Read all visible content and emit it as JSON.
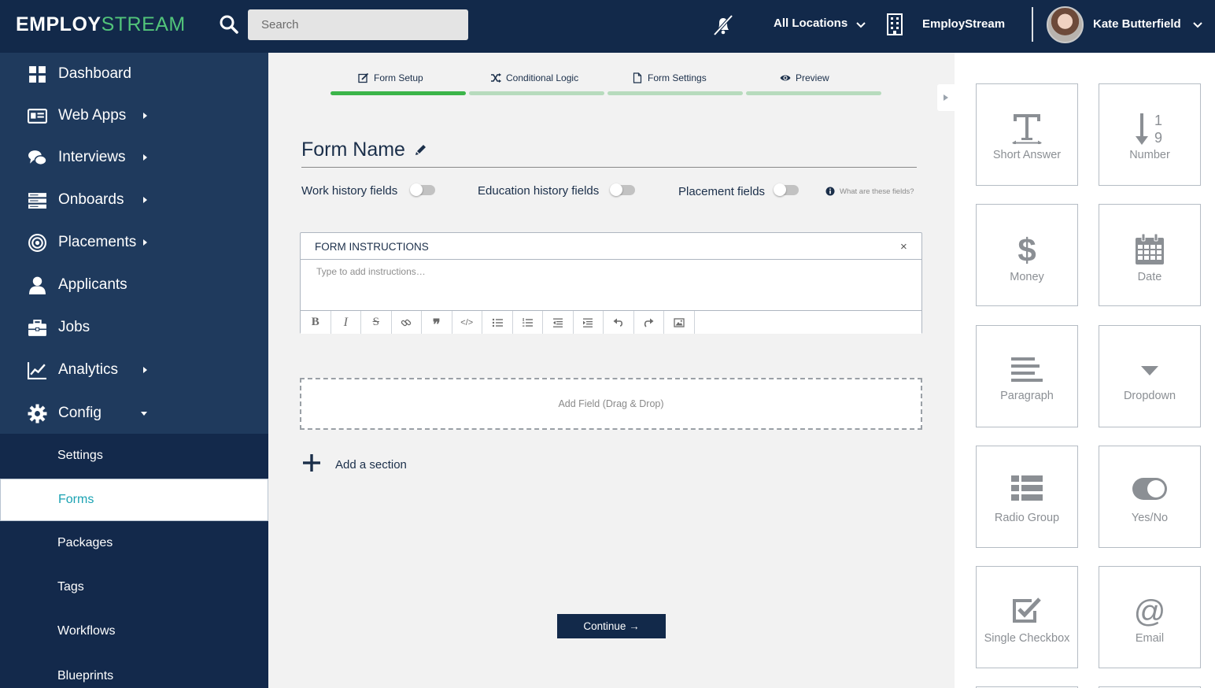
{
  "topbar": {
    "logo_part1": "EMPLOY",
    "logo_part2": "STREAM",
    "search_placeholder": "Search",
    "location": "All Locations",
    "organization": "EmployStream",
    "user_name": "Kate Butterfield",
    "icons": [
      "search-icon",
      "bell-off-icon",
      "chevron-down-icon",
      "building-icon",
      "chevron-down-icon"
    ]
  },
  "sidebar": {
    "items": [
      {
        "label": "Dashboard",
        "icon": "grid-icon",
        "has_submenu": false
      },
      {
        "label": "Web Apps",
        "icon": "id-card-icon",
        "has_submenu": true
      },
      {
        "label": "Interviews",
        "icon": "chat-icon",
        "has_submenu": true
      },
      {
        "label": "Onboards",
        "icon": "server-icon",
        "has_submenu": true
      },
      {
        "label": "Placements",
        "icon": "target-icon",
        "has_submenu": true
      },
      {
        "label": "Applicants",
        "icon": "user-icon",
        "has_submenu": false
      },
      {
        "label": "Jobs",
        "icon": "briefcase-icon",
        "has_submenu": false
      },
      {
        "label": "Analytics",
        "icon": "line-chart-icon",
        "has_submenu": true
      },
      {
        "label": "Config",
        "icon": "gear-icon",
        "has_submenu": true,
        "expanded": true
      }
    ],
    "config_subitems": [
      {
        "label": "Settings",
        "active": false
      },
      {
        "label": "Forms",
        "active": true
      },
      {
        "label": "Packages",
        "active": false
      },
      {
        "label": "Tags",
        "active": false
      },
      {
        "label": "Workflows",
        "active": false
      },
      {
        "label": "Blueprints",
        "active": false
      }
    ]
  },
  "steps": [
    {
      "label": "Form Setup",
      "icon": "edit-icon",
      "active": true
    },
    {
      "label": "Conditional Logic",
      "icon": "shuffle-icon",
      "active": false
    },
    {
      "label": "Form Settings",
      "icon": "file-icon",
      "active": false
    },
    {
      "label": "Preview",
      "icon": "eye-icon",
      "active": false
    }
  ],
  "form": {
    "title": "Form Name",
    "toggles": [
      {
        "label": "Work history fields",
        "on": false
      },
      {
        "label": "Education history fields",
        "on": false
      },
      {
        "label": "Placement fields",
        "on": false
      }
    ],
    "info_text": "What are these fields?",
    "instructions_title": "FORM INSTRUCTIONS",
    "instructions_close": "×",
    "instructions_placeholder": "Type to add instructions…",
    "toolbar_buttons": [
      "bold",
      "italic",
      "strikethrough",
      "link",
      "quote",
      "code",
      "bullet-list",
      "numbered-list",
      "outdent",
      "indent",
      "undo",
      "redo",
      "image"
    ],
    "dropzone_text": "Add Field (Drag & Drop)",
    "add_section": "Add a section",
    "continue": "Continue →"
  },
  "field_palette": [
    {
      "label": "Short Answer",
      "icon": "text-t-icon"
    },
    {
      "label": "Number",
      "icon": "number-sort-icon"
    },
    {
      "label": "Money",
      "icon": "dollar-icon"
    },
    {
      "label": "Date",
      "icon": "calendar-icon"
    },
    {
      "label": "Paragraph",
      "icon": "paragraph-icon"
    },
    {
      "label": "Dropdown",
      "icon": "caret-down-icon"
    },
    {
      "label": "Radio Group",
      "icon": "list-icon"
    },
    {
      "label": "Yes/No",
      "icon": "toggle-icon"
    },
    {
      "label": "Single Checkbox",
      "icon": "checkbox-icon"
    },
    {
      "label": "Email",
      "icon": "at-icon"
    }
  ],
  "colors": {
    "navy": "#12294a",
    "sidebar_upper": "#1f3a5d",
    "accent_green": "#3cb54a",
    "active_link": "#1ba3b3"
  }
}
